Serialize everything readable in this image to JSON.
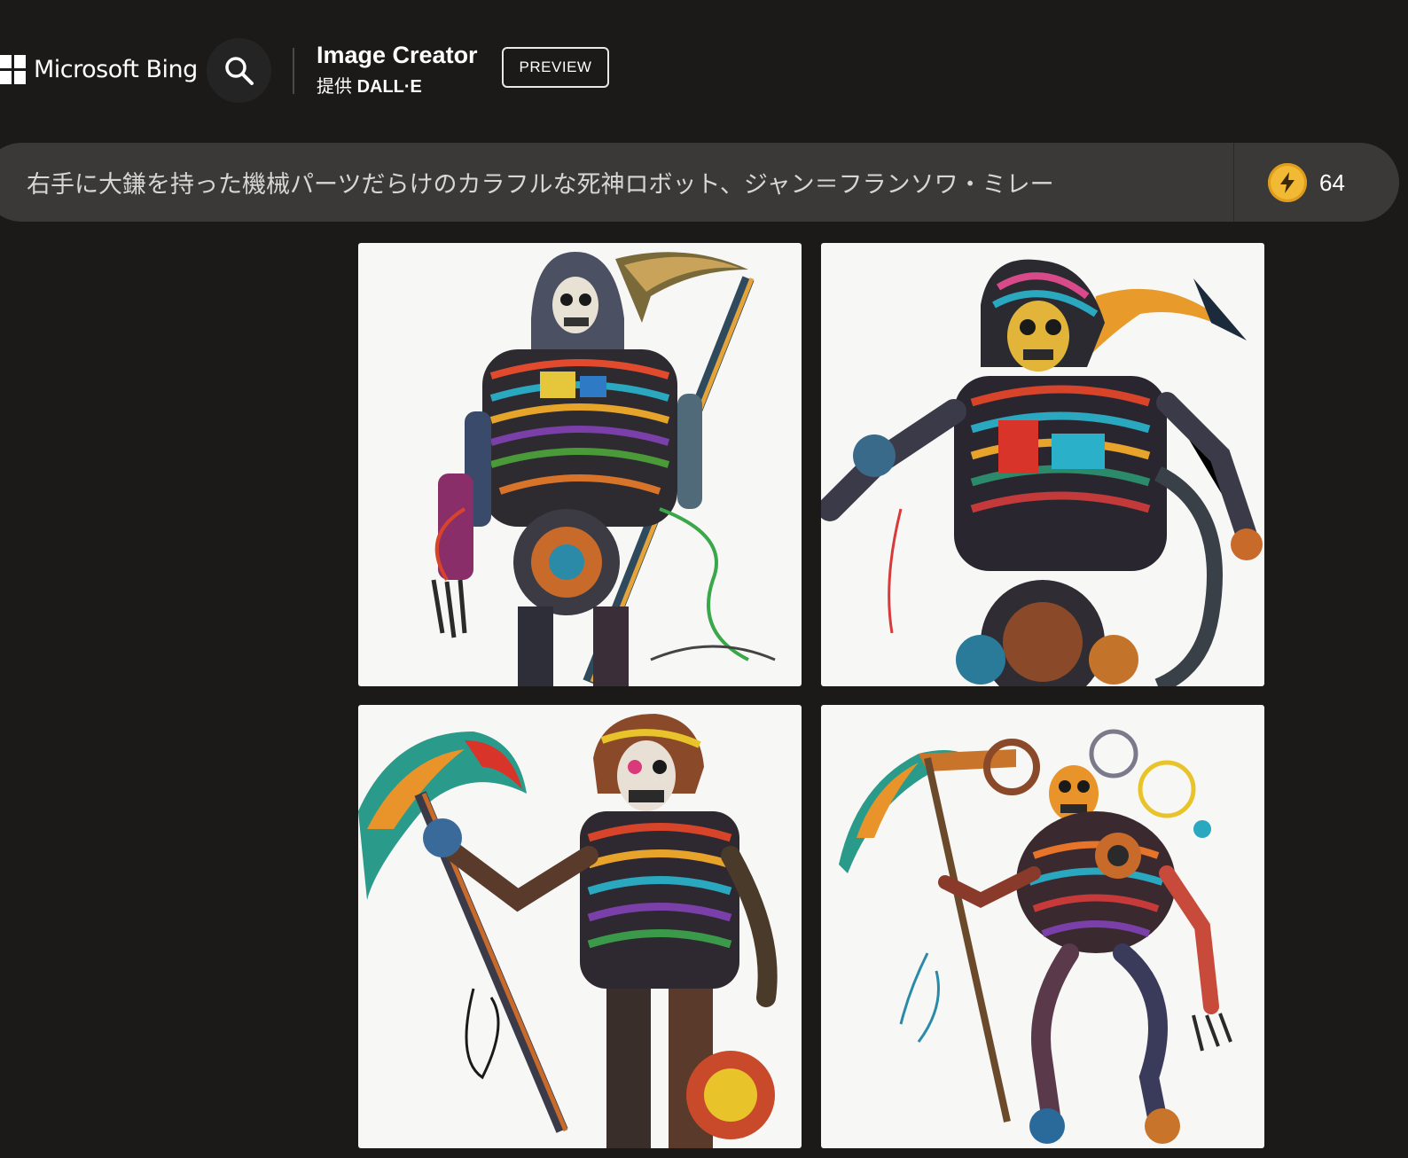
{
  "header": {
    "brand": "Microsoft Bing",
    "app_title": "Image Creator",
    "app_sub_prefix": "提供",
    "app_sub_engine": "DALL·E",
    "badge": "PREVIEW"
  },
  "prompt": {
    "value": "右手に大鎌を持った機械パーツだらけのカラフルな死神ロボット、ジャン＝フランソワ・ミレー"
  },
  "boosts": {
    "count": "64"
  },
  "images": [
    {
      "name": "generated-image-1",
      "subject": "hooded skeleton robot with scythe"
    },
    {
      "name": "generated-image-2",
      "subject": "hooded skeleton robot with scythe"
    },
    {
      "name": "generated-image-3",
      "subject": "helmeted skeleton robot with scythe"
    },
    {
      "name": "generated-image-4",
      "subject": "skeleton robot with gears and scythe"
    }
  ],
  "colors": {
    "background": "#1b1a19",
    "prompt_bar": "#3a3938",
    "boost_icon": "#f2b934"
  }
}
